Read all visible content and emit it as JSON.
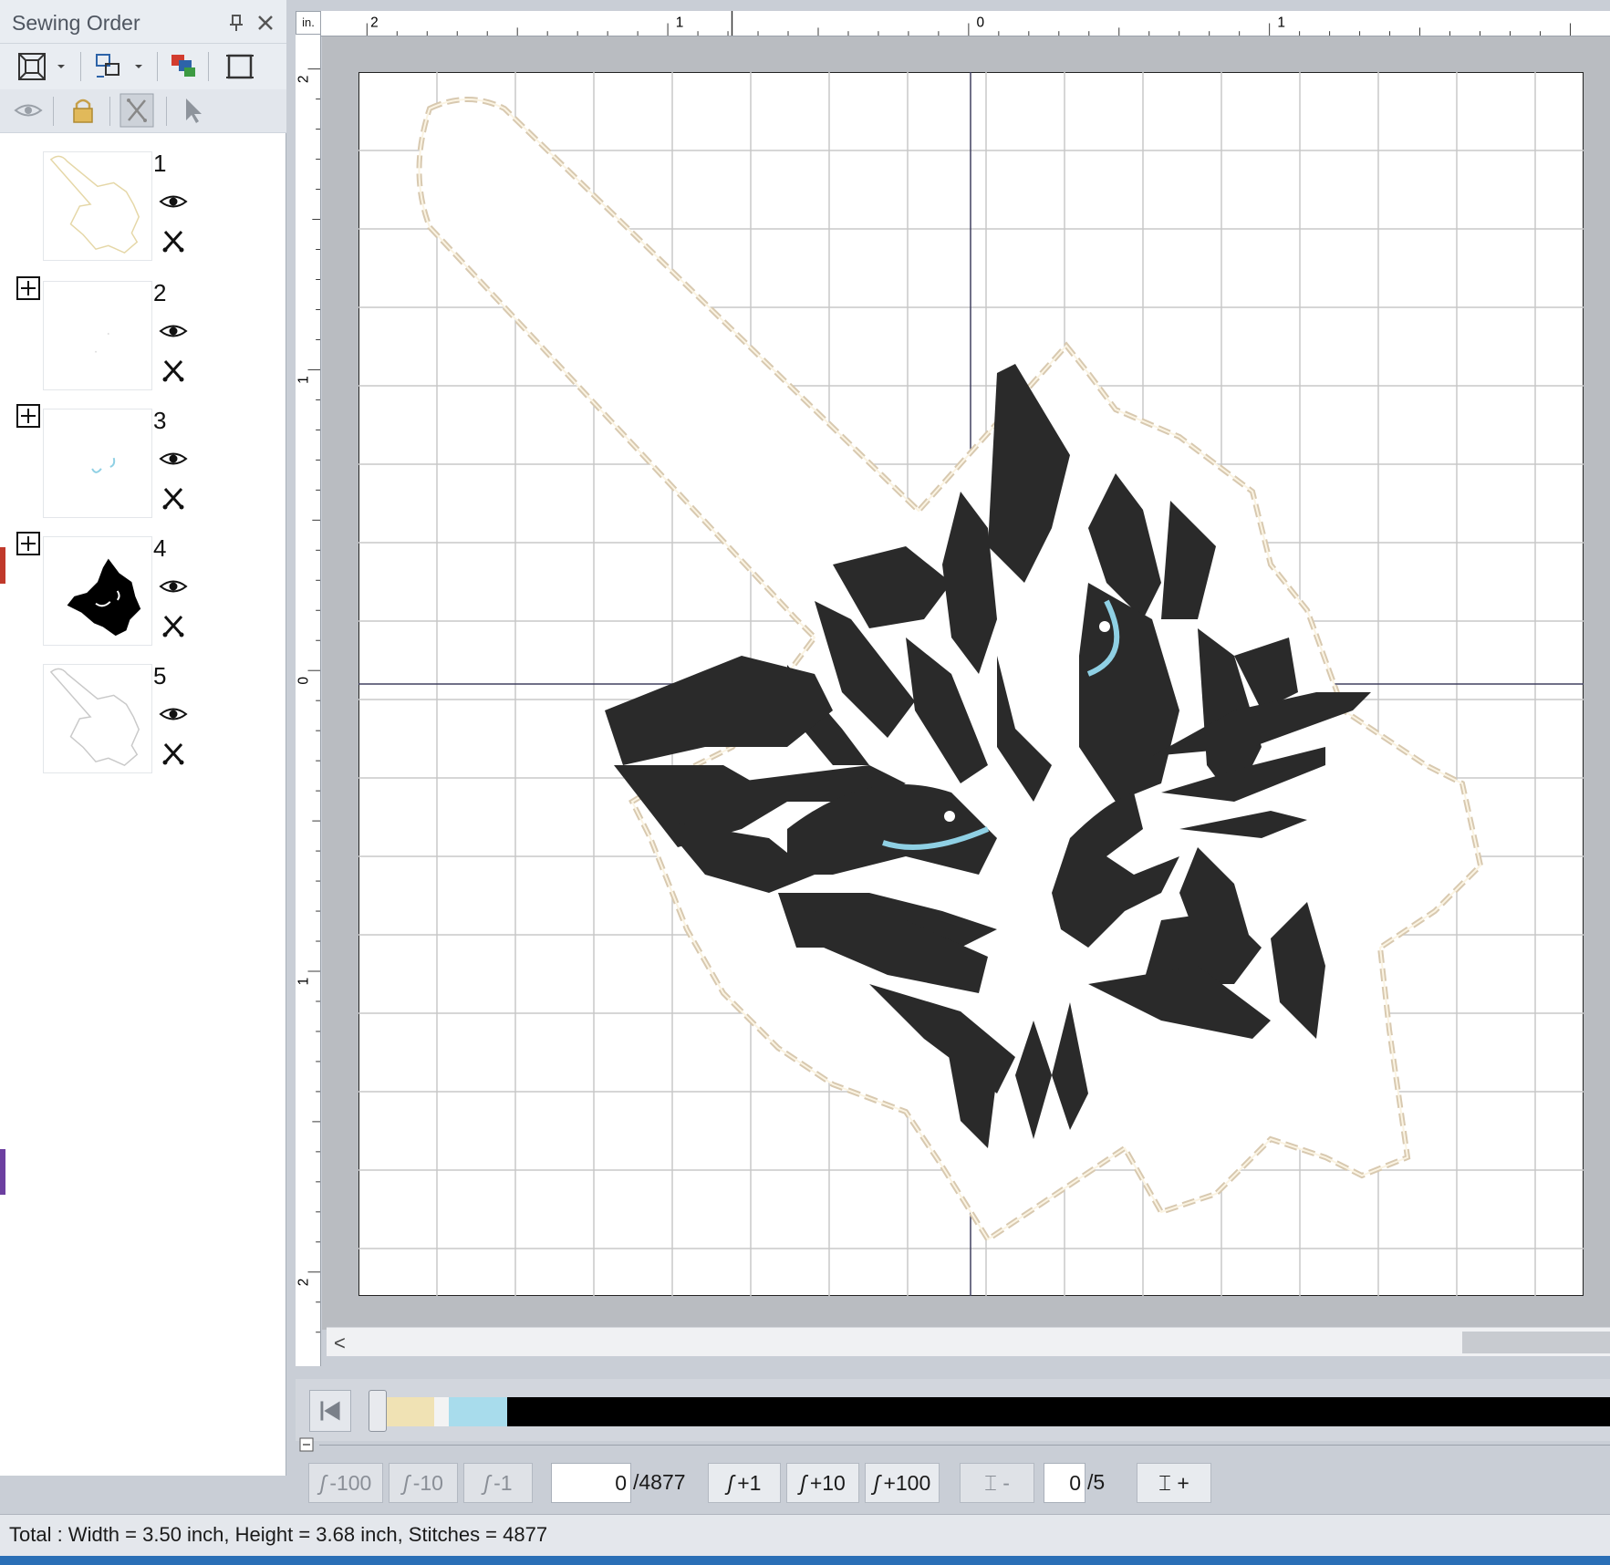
{
  "panel": {
    "title": "Sewing Order",
    "items": [
      {
        "num": "1",
        "expandable": false
      },
      {
        "num": "2",
        "expandable": true
      },
      {
        "num": "3",
        "expandable": true
      },
      {
        "num": "4",
        "expandable": true
      },
      {
        "num": "5",
        "expandable": false
      }
    ]
  },
  "ruler": {
    "unit": "in.",
    "top_labels": [
      "2",
      "1",
      "0",
      "1"
    ],
    "left_labels": [
      "2",
      "1",
      "0",
      "1",
      "2"
    ]
  },
  "simulator": {
    "current_stitch": "0",
    "total_stitches": "/4877",
    "current_color": "0",
    "total_colors": "/5",
    "buttons": {
      "back100": "-100",
      "back10": "-10",
      "back1": "-1",
      "fwd1": "+1",
      "fwd10": "+10",
      "fwd100": "+100",
      "color_prev": "-",
      "color_next": "+"
    },
    "colors": {
      "thread1": "#f0e2b4",
      "thread3": "#a8dcec",
      "thread4": "#000000"
    }
  },
  "status": {
    "text": "Total : Width = 3.50 inch, Height = 3.68 inch, Stitches = 4877"
  }
}
